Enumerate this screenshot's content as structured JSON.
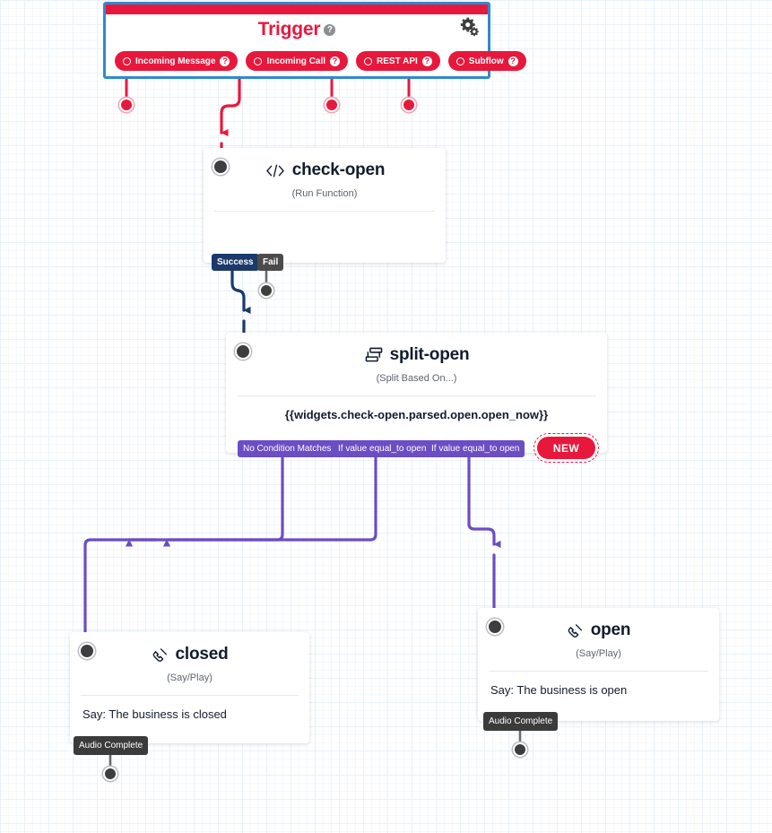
{
  "canvas": {
    "background_color": "#ffffff",
    "grid_color": "#e8f1fb"
  },
  "trigger": {
    "title": "Trigger",
    "help_glyph": "?",
    "border_color": "#3089cf",
    "accent_color": "#e8183d",
    "settings_icon": "gear-icon",
    "pills": [
      {
        "label": "Incoming Message",
        "help_glyph": "?"
      },
      {
        "label": "Incoming Call",
        "help_glyph": "?"
      },
      {
        "label": "REST API",
        "help_glyph": "?"
      },
      {
        "label": "Subflow",
        "help_glyph": "?"
      }
    ]
  },
  "nodes": {
    "check_open": {
      "title": "check-open",
      "subtitle": "(Run Function)",
      "icon": "code-icon",
      "body": "",
      "outcomes": [
        {
          "label": "Success",
          "color": "#1b3a6b"
        },
        {
          "label": "Fail",
          "color": "#4b4b4b"
        }
      ]
    },
    "split_open": {
      "title": "split-open",
      "subtitle": "(Split Based On...)",
      "icon": "split-icon",
      "body": "{{widgets.check-open.parsed.open.open_now}}",
      "outcomes": [
        {
          "label": "No Condition Matches",
          "color": "#6b4dc4"
        },
        {
          "label": "If value equal_to open",
          "color": "#6b4dc4"
        },
        {
          "label": "If value equal_to open",
          "color": "#6b4dc4"
        }
      ],
      "new_button": {
        "label": "NEW",
        "color": "#e8183d"
      }
    },
    "closed": {
      "title": "closed",
      "subtitle": "(Say/Play)",
      "icon": "phone-icon",
      "body": "Say: The business is closed",
      "outcomes": [
        {
          "label": "Audio Complete",
          "color": "#3b3b3b"
        }
      ]
    },
    "open": {
      "title": "open",
      "subtitle": "(Say/Play)",
      "icon": "phone-icon",
      "body": "Say: The business is open",
      "outcomes": [
        {
          "label": "Audio Complete",
          "color": "#3b3b3b"
        }
      ]
    }
  },
  "connectors": {
    "trigger_to_check_open_color": "#e8183d",
    "success_to_split_color": "#1b3a6b",
    "split_to_say_color": "#6b4dc4",
    "outcome_stub_color": "#6b6b6b"
  }
}
